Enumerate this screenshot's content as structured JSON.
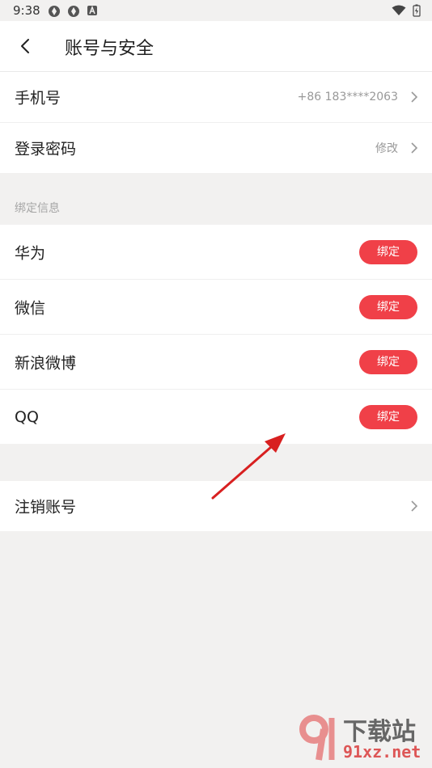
{
  "status": {
    "time": "9:38"
  },
  "header": {
    "title": "账号与安全"
  },
  "account": {
    "phone_label": "手机号",
    "phone_value": "+86 183****2063",
    "password_label": "登录密码",
    "password_value": "修改"
  },
  "binding": {
    "section_label": "绑定信息",
    "items": [
      {
        "label": "华为",
        "button": "绑定"
      },
      {
        "label": "微信",
        "button": "绑定"
      },
      {
        "label": "新浪微博",
        "button": "绑定"
      },
      {
        "label": "QQ",
        "button": "绑定"
      }
    ]
  },
  "cancel": {
    "label": "注销账号"
  },
  "watermark": {
    "brand": "下载站",
    "site": "91xz.net"
  },
  "colors": {
    "accent": "#f04048",
    "background": "#f2f1f0",
    "arrow": "#d82020"
  }
}
